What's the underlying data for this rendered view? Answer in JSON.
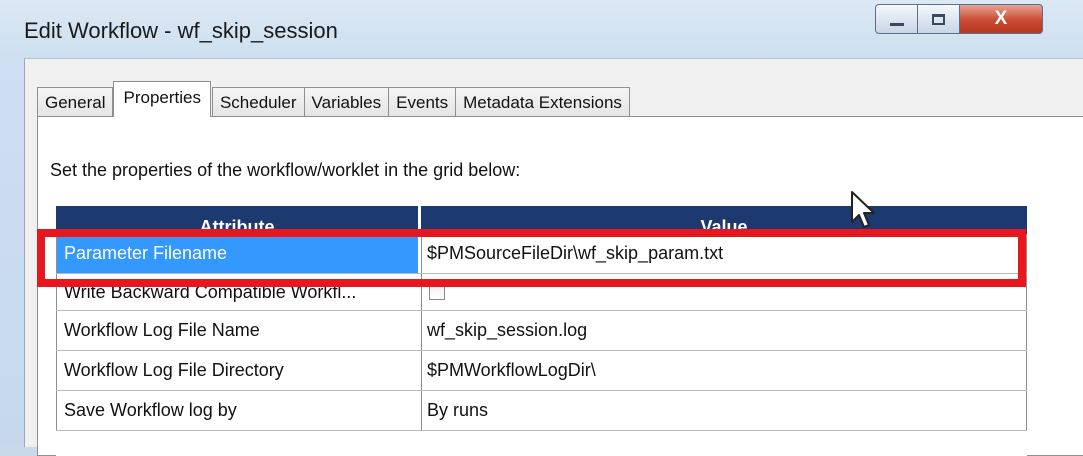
{
  "window": {
    "title": "Edit Workflow - wf_skip_session",
    "close_glyph": "X"
  },
  "tabs": [
    {
      "label": "General",
      "active": false
    },
    {
      "label": "Properties",
      "active": true
    },
    {
      "label": "Scheduler",
      "active": false
    },
    {
      "label": "Variables",
      "active": false
    },
    {
      "label": "Events",
      "active": false
    },
    {
      "label": "Metadata Extensions",
      "active": false
    }
  ],
  "instruction": "Set the properties of the workflow/worklet in the grid below:",
  "grid": {
    "columns": {
      "attribute": "Attribute",
      "value": "Value"
    },
    "rows": [
      {
        "attribute": "Parameter Filename",
        "value": "$PMSourceFileDir\\wf_skip_param.txt",
        "selected": true
      },
      {
        "attribute": "Write Backward Compatible Workfl...",
        "value": "",
        "checkbox": true,
        "checked": false
      },
      {
        "attribute": "Workflow Log File Name",
        "value": "wf_skip_session.log"
      },
      {
        "attribute": "Workflow Log File Directory",
        "value": "$PMWorkflowLogDir\\"
      },
      {
        "attribute": "Save Workflow log by",
        "value": "By runs"
      }
    ]
  },
  "colors": {
    "header_bg": "#1c3a6f",
    "selection": "#3399ff",
    "highlight_box": "#e8161f"
  }
}
